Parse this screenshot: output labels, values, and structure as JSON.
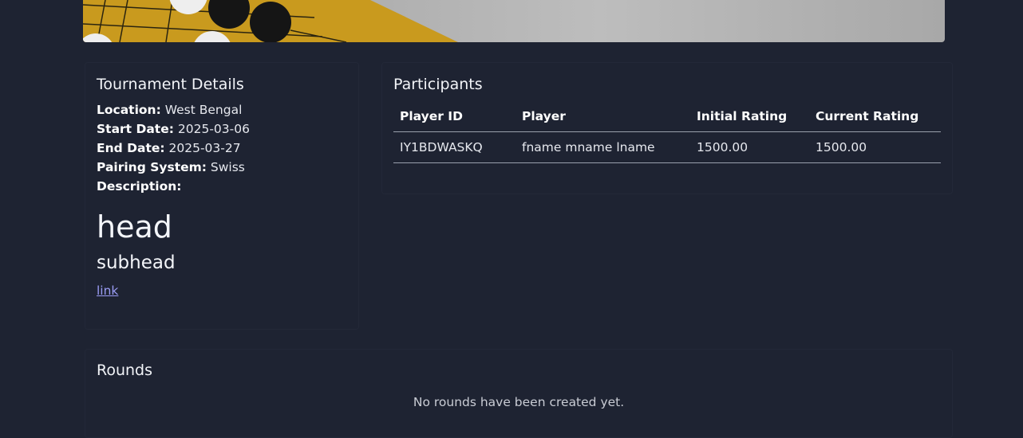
{
  "details": {
    "title": "Tournament Details",
    "location_label": "Location:",
    "location": "West Bengal",
    "start_label": "Start Date:",
    "start_date": "2025-03-06",
    "end_label": "End Date:",
    "end_date": "2025-03-27",
    "pairing_label": "Pairing System:",
    "pairing_system": "Swiss",
    "description_label": "Description:",
    "description": {
      "head": "head",
      "subhead": "subhead",
      "link": "link"
    }
  },
  "participants": {
    "title": "Participants",
    "columns": [
      "Player ID",
      "Player",
      "Initial Rating",
      "Current Rating"
    ],
    "rows": [
      [
        "IY1BDWASKQ",
        "fname mname lname",
        "1500.00",
        "1500.00"
      ]
    ]
  },
  "rounds": {
    "title": "Rounds",
    "empty_text": "No rounds have been created yet."
  },
  "colors": {
    "background": "#1e2332",
    "board": "#c99a1e",
    "link": "#9a9cf4"
  }
}
